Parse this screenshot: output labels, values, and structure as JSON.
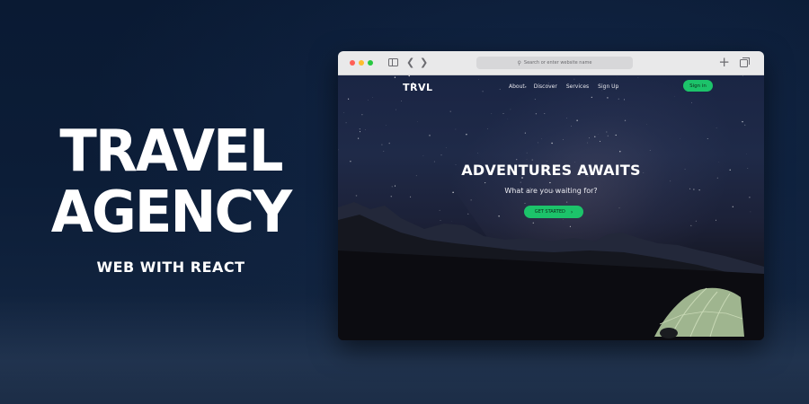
{
  "promo": {
    "title_line1": "TRAVEL",
    "title_line2": "AGENCY",
    "subtitle": "WEB WITH REACT"
  },
  "browser": {
    "address_placeholder": "Search or enter website name",
    "icons": [
      "sidebar-icon",
      "back-icon",
      "forward-icon",
      "search-icon",
      "plus-icon",
      "tabs-icon"
    ]
  },
  "site": {
    "logo": "TRVL",
    "nav": [
      "About",
      "Discover",
      "Services",
      "Sign Up"
    ],
    "signin_label": "Sign in",
    "hero_title": "ADVENTURES AWAITS",
    "hero_subtitle": "What are you waiting for?",
    "cta_label": "GET STARTED",
    "cta_arrow": "›"
  },
  "colors": {
    "accent_green": "#1cc36a",
    "page_background": "#0c1d37"
  }
}
